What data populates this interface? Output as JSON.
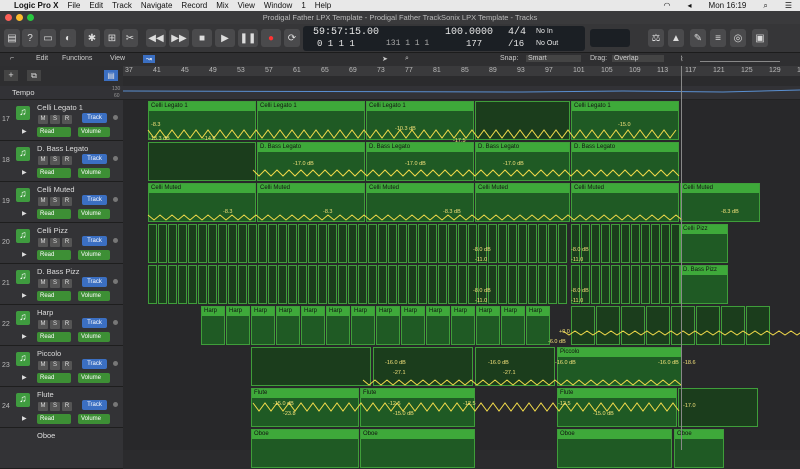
{
  "menubar": {
    "apple": "",
    "app": "Logic Pro X",
    "items": [
      "File",
      "Edit",
      "Track",
      "Navigate",
      "Record",
      "Mix",
      "View",
      "Window",
      "1",
      "Help"
    ],
    "clock": "Mon 16:19"
  },
  "window": {
    "title": "Prodigal Father LPX Template - Prodigal Father TrackSonix LPX Template - Tracks"
  },
  "lcd": {
    "time": "59:57:15.00",
    "bars": "0 1 1   1",
    "position2": "131 1 1 1",
    "tempo": "100.0000",
    "signature": "4/4",
    "division": "/16",
    "beats": "177",
    "in": "No In",
    "out": "No Out"
  },
  "secbar": {
    "edit": "Edit",
    "functions": "Functions",
    "view": "View",
    "snap_label": "Snap:",
    "snap_value": "Smart",
    "drag_label": "Drag:",
    "drag_value": "Overlap"
  },
  "ruler": [
    "37",
    "41",
    "45",
    "49",
    "53",
    "57",
    "61",
    "65",
    "69",
    "73",
    "77",
    "81",
    "85",
    "89",
    "93",
    "97",
    "101",
    "105",
    "109",
    "113",
    "117",
    "121",
    "125",
    "129",
    "133"
  ],
  "tempo_label": "Tempo",
  "tempo_values": [
    "130",
    "60"
  ],
  "tracks": [
    {
      "num": "17",
      "name": "Celli Legato 1",
      "read": "Read",
      "vol": "Volume",
      "type": "Track"
    },
    {
      "num": "18",
      "name": "D. Bass Legato",
      "read": "Read",
      "vol": "Volume",
      "type": "Track"
    },
    {
      "num": "19",
      "name": "Celli Muted",
      "read": "Read",
      "vol": "Volume",
      "type": "Track"
    },
    {
      "num": "20",
      "name": "Celli Pizz",
      "read": "Read",
      "vol": "Volume",
      "type": "Track"
    },
    {
      "num": "21",
      "name": "D. Bass Pizz",
      "read": "Read",
      "vol": "Volume",
      "type": "Track"
    },
    {
      "num": "22",
      "name": "Harp",
      "read": "Read",
      "vol": "Volume",
      "type": "Track"
    },
    {
      "num": "23",
      "name": "Piccolo",
      "read": "Read",
      "vol": "Volume",
      "type": "Track"
    },
    {
      "num": "24",
      "name": "Flute",
      "read": "Read",
      "vol": "Volume",
      "type": "Track"
    },
    {
      "num": "",
      "name": "Oboe",
      "read": "",
      "vol": "",
      "type": ""
    }
  ],
  "msr": [
    "M",
    "S",
    "R"
  ],
  "regions": {
    "celli_legato": "Celli Legato 1",
    "dbass_legato": "D. Bass Legato",
    "celli_muted": "Celli Muted",
    "celli_pizz": "Celli Pizz",
    "dbass_pizz": "D. Bass Pizz",
    "harp": "Harp",
    "piccolo": "Piccolo",
    "flute": "Flute",
    "oboe": "Oboe"
  },
  "auto_labels": {
    "a": "-8.3",
    "b": "-13.3 dB",
    "c": "-14.6",
    "d": "-10.3 dB",
    "e": "-15.0",
    "f": "-17.5",
    "g": "-17.0 dB",
    "h": "-8.0 dB",
    "i": "-11.0",
    "j": "-6.0 dB",
    "k": "+0.0",
    "l": "-16.0 dB",
    "m": "-27.1",
    "n": "-15.0 dB",
    "o": "-23.8",
    "p": "-12.5",
    "q": "-18.6",
    "r": "-17.0",
    "s": "-8.3 dB"
  }
}
